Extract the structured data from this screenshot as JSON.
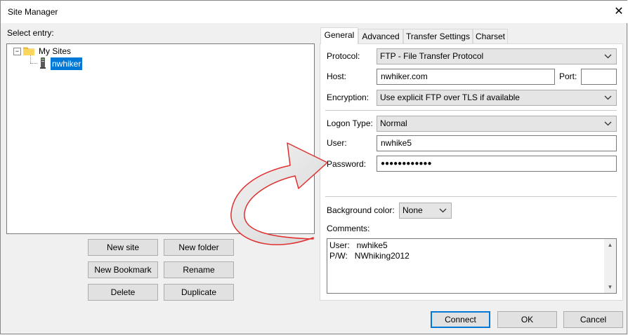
{
  "window": {
    "title": "Site Manager"
  },
  "left": {
    "select_entry_label": "Select entry:",
    "tree": {
      "root": {
        "label": "My Sites",
        "icon": "folder-icon",
        "expander": "−"
      },
      "child": {
        "label": "nwhiker",
        "icon": "server-icon"
      }
    },
    "buttons": {
      "new_site": "New site",
      "new_folder": "New folder",
      "new_bookmark": "New Bookmark",
      "rename": "Rename",
      "delete": "Delete",
      "duplicate": "Duplicate"
    }
  },
  "tabs": [
    "General",
    "Advanced",
    "Transfer Settings",
    "Charset"
  ],
  "general": {
    "protocol_label": "Protocol:",
    "protocol_value": "FTP - File Transfer Protocol",
    "host_label": "Host:",
    "host_value": "nwhiker.com",
    "port_label": "Port:",
    "port_value": "",
    "encryption_label": "Encryption:",
    "encryption_value": "Use explicit FTP over TLS if available",
    "logon_type_label": "Logon Type:",
    "logon_type_value": "Normal",
    "user_label": "User:",
    "user_value": "nwhike5",
    "password_label": "Password:",
    "password_value": "●●●●●●●●●●●●",
    "bg_color_label": "Background color:",
    "bg_color_value": "None",
    "comments_label": "Comments:",
    "comments_lines": [
      "User:   nwhike5",
      "P/W:   NWhiking2012"
    ]
  },
  "footer": {
    "connect": "Connect",
    "ok": "OK",
    "cancel": "Cancel"
  },
  "colors": {
    "selection": "#0078d7",
    "annotation_arrow": "#e03030",
    "default_button_border": "#0078d7"
  }
}
